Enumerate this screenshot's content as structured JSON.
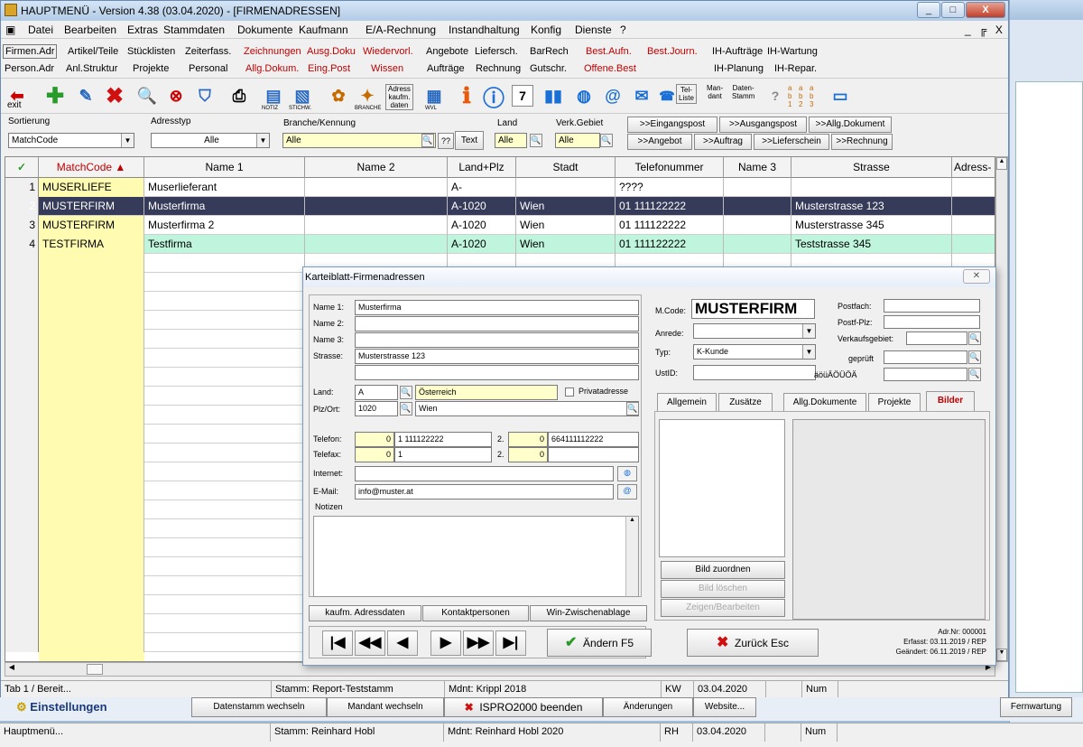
{
  "window": {
    "title": "HAUPTMENÜ  - Version 4.38 (03.04.2020) - [FIRMENADRESSEN]",
    "minimize": "_",
    "maximize": "□",
    "close": "X",
    "mdi_controls": "_ ╔ X"
  },
  "menu": [
    "Datei",
    "Bearbeiten",
    "Extras",
    "Stammdaten",
    "Dokumente",
    "Kaufmann",
    "E/A-Rechnung",
    "Instandhaltung",
    "Konfig",
    "Dienste",
    "?"
  ],
  "quick_row1": {
    "firmen_adr": "Firmen.Adr",
    "artikel": "Artikel/Teile",
    "stuecklisten": "Stücklisten",
    "zeiterfass": "Zeiterfass.",
    "zeichnungen": "Zeichnungen",
    "ausg_doku": "Ausg.Doku",
    "wiedervorl": "Wiedervorl.",
    "angebote": "Angebote",
    "liefersch": "Liefersch.",
    "barrech": "BarRech",
    "best_aufn": "Best.Aufn.",
    "best_journ": "Best.Journ.",
    "ih_auftraege": "IH-Aufträge",
    "ih_wartung": "IH-Wartung"
  },
  "quick_row2": {
    "person_adr": "Person.Adr",
    "anl_struktur": "Anl.Struktur",
    "projekte": "Projekte",
    "personal": "Personal",
    "allg_dokum": "Allg.Dokum.",
    "eing_post": "Eing.Post",
    "wissen": "Wissen",
    "auftraege": "Aufträge",
    "rechnung": "Rechnung",
    "gutschr": "Gutschr.",
    "offene_best": "Offene.Best",
    "ih_planung": "IH-Planung",
    "ih_repar": "IH-Repar."
  },
  "toolbar": {
    "exit": "exit",
    "notiz": "NOTIZ",
    "stichw": "STICHW.",
    "branche": "BRANCHE",
    "adress_kaufm": "Adress\nkaufm.\ndaten",
    "wvl": "WVL",
    "calendar_day": "7",
    "tel_liste": "Tel-\nListe",
    "mandant": "Man-\ndant",
    "datenstamm": "Daten-\nStamm",
    "abc": "a\nb\n1",
    "abc2": "a\nb\n2",
    "abc3": "a\nb\n3"
  },
  "filters": {
    "sortierung_label": "Sortierung",
    "sortierung_value": "MatchCode",
    "adresstyp_label": "Adresstyp",
    "adresstyp_value": "Alle",
    "branche_label": "Branche/Kennung",
    "branche_value": "Alle",
    "qq": "??",
    "text_btn": "Text",
    "land_label": "Land",
    "land_value": "Alle",
    "verk_label": "Verk.Gebiet",
    "verk_value": "Alle",
    "eingangspost": ">>Eingangspost",
    "ausgangspost": ">>Ausgangspost",
    "allg_dokument": ">>Allg.Dokument",
    "angebot": ">>Angebot",
    "auftrag": ">>Auftrag",
    "lieferschein": ">>Lieferschein",
    "rechnung": ">>Rechnung"
  },
  "grid": {
    "check": "✓",
    "headers": [
      "MatchCode ▲",
      "Name 1",
      "Name 2",
      "Land+Plz",
      "Stadt",
      "Telefonummer",
      "Name 3",
      "Strasse",
      "Adress-"
    ],
    "rows": [
      {
        "n": "1",
        "match": "MUSERLIEFE",
        "name1": "Muserlieferant",
        "name2": "",
        "plz": "A-",
        "stadt": "",
        "tel": "????",
        "name3": "",
        "strasse": ""
      },
      {
        "n": "2",
        "match": "MUSTERFIRM",
        "name1": "Musterfirma",
        "name2": "",
        "plz": "A-1020",
        "stadt": "Wien",
        "tel": "01 111122222",
        "name3": "",
        "strasse": "Musterstrasse 123"
      },
      {
        "n": "3",
        "match": "MUSTERFIRM",
        "name1": "Musterfirma 2",
        "name2": "",
        "plz": "A-1020",
        "stadt": "Wien",
        "tel": "01 111122222",
        "name3": "",
        "strasse": "Musterstrasse 345"
      },
      {
        "n": "4",
        "match": "TESTFIRMA",
        "name1": "Testfirma",
        "name2": "",
        "plz": "A-1020",
        "stadt": "Wien",
        "tel": "01 111122222",
        "name3": "",
        "strasse": "Teststrasse 345"
      }
    ]
  },
  "dialog": {
    "title": "Karteiblatt-Firmenadressen",
    "name1_label": "Name 1:",
    "name1": "Musterfirma",
    "name2_label": "Name 2:",
    "name3_label": "Name 3:",
    "strasse_label": "Strasse:",
    "strasse": "Musterstrasse 123",
    "land_label": "Land:",
    "land": "A",
    "land_name": "Österreich",
    "privat": "Privatadresse",
    "plz_label": "Plz/Ort:",
    "plz": "1020",
    "ort": "Wien",
    "telefon_label": "Telefon:",
    "tel_a": "0",
    "tel_b": "1 111122222",
    "tel2_label": "2.",
    "tel2_a": "0",
    "tel2_b": "664111112222",
    "telefax_label": "Telefax:",
    "fax_a": "0",
    "fax_b": "1",
    "fax2_label": "2.",
    "fax2_a": "0",
    "internet_label": "Internet:",
    "email_label": "E-Mail:",
    "email": "info@muster.at",
    "notizen": "Notizen",
    "mcode_label": "M.Code:",
    "mcode": "MUSTERFIRM",
    "anrede_label": "Anrede:",
    "typ_label": "Typ:",
    "typ": "K-Kunde",
    "ustid_label": "UstID:",
    "postfach": "Postfach:",
    "postf_plz": "Postf-Plz:",
    "verkaufsgebiet": "Verkaufsgebiet:",
    "geprueft": "geprüft",
    "umlaute": "äöüÄÖÜÖÄ",
    "tabs": [
      "Allgemein",
      "Zusätze",
      "Allg.Dokumente",
      "Projekte",
      "Bilder"
    ],
    "bild_zuordnen": "Bild zuordnen",
    "bild_loeschen": "Bild löschen",
    "zeigen": "Zeigen/Bearbeiten",
    "btn_kaufm": "kaufm. Adressdaten",
    "btn_kontakt": "Kontaktpersonen",
    "btn_win": "Win-Zwischenablage",
    "aendern": "Ändern F5",
    "zurueck": "Zurück Esc",
    "adrnr": "Adr.Nr: 000001",
    "erfasst": "Erfasst: 03.11.2019 / REP",
    "geaendert": "Geändert: 06.11.2019 / REP",
    "colors": {
      "highlight_row": "#363b5a",
      "match_yellow": "#fffbb0",
      "test_row": "#bff5dd"
    }
  },
  "status": {
    "tab": "Tab 1 / Bereit...",
    "stamm": "Stamm: Report-Teststamm",
    "mdnt": "Mdnt: Krippl 2018",
    "kw": "KW",
    "date": "03.04.2020",
    "num": "Num"
  },
  "bottom1": {
    "einstellungen": "Einstellungen",
    "datenstamm": "Datenstamm wechseln",
    "mandant": "Mandant wechseln",
    "ispro": "ISPRO2000 beenden",
    "aenderungen": "Änderungen",
    "website": "Website...",
    "fernwartung": "Fernwartung"
  },
  "bottom2": {
    "haupt": "Hauptmenü...",
    "stamm": "Stamm: Reinhard Hobl",
    "mdnt": "Mdnt: Reinhard Hobl 2020",
    "rh": "RH",
    "date": "03.04.2020",
    "num": "Num"
  }
}
